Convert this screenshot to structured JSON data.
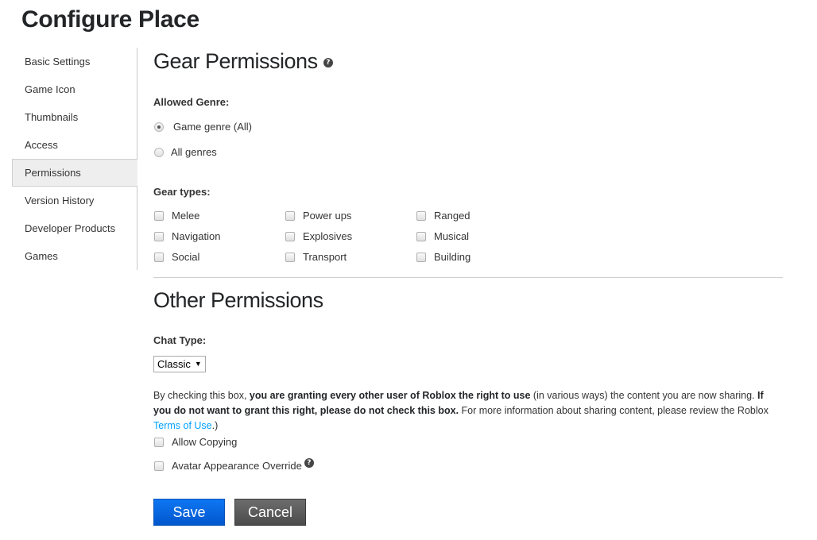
{
  "page": {
    "title": "Configure Place"
  },
  "sidebar": {
    "items": [
      {
        "label": "Basic Settings",
        "active": false
      },
      {
        "label": "Game Icon",
        "active": false
      },
      {
        "label": "Thumbnails",
        "active": false
      },
      {
        "label": "Access",
        "active": false
      },
      {
        "label": "Permissions",
        "active": true
      },
      {
        "label": "Version History",
        "active": false
      },
      {
        "label": "Developer Products",
        "active": false
      },
      {
        "label": "Games",
        "active": false
      }
    ]
  },
  "gear": {
    "title": "Gear Permissions",
    "help_icon": "question-circle-icon",
    "allowed_genre_label": "Allowed Genre:",
    "genres": [
      {
        "label": "Game genre (All)",
        "checked": true
      },
      {
        "label": "All genres",
        "checked": false
      }
    ],
    "gear_types_label": "Gear types:",
    "types": [
      {
        "label": "Melee",
        "checked": false
      },
      {
        "label": "Power ups",
        "checked": false
      },
      {
        "label": "Ranged",
        "checked": false
      },
      {
        "label": "Navigation",
        "checked": false
      },
      {
        "label": "Explosives",
        "checked": false
      },
      {
        "label": "Musical",
        "checked": false
      },
      {
        "label": "Social",
        "checked": false
      },
      {
        "label": "Transport",
        "checked": false
      },
      {
        "label": "Building",
        "checked": false
      }
    ]
  },
  "other": {
    "title": "Other Permissions",
    "chat_type_label": "Chat Type:",
    "chat_type_value": "Classic",
    "disclaimer": {
      "part1": "By checking this box, ",
      "bold1": "you are granting every other user of Roblox the right to use",
      "part2": " (in various ways) the content you are now sharing. ",
      "bold2": "If you do not want to grant this right, please do not check this box.",
      "part3": " For more information about sharing content, please review the Roblox ",
      "link": "Terms of Use",
      "part4": ".)"
    },
    "allow_copying": {
      "label": "Allow Copying",
      "checked": false
    },
    "avatar_override": {
      "label": "Avatar Appearance Override",
      "checked": false
    }
  },
  "buttons": {
    "save": "Save",
    "cancel": "Cancel"
  },
  "colors": {
    "save": "#0a6ae8",
    "cancel": "#5c5c5c",
    "link": "#00a2ff"
  }
}
